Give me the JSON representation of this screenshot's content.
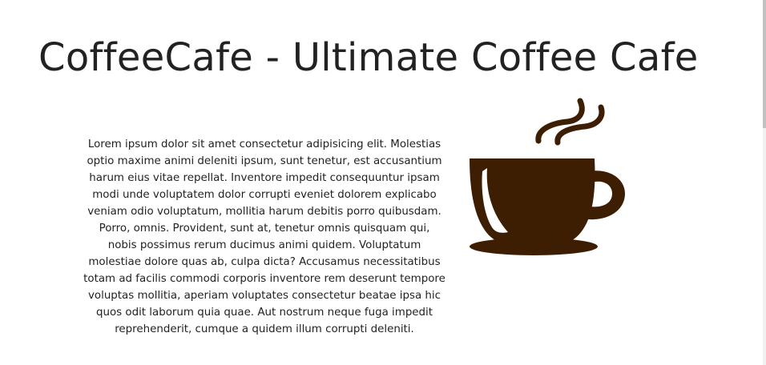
{
  "page": {
    "title": "CoffeeCafe - Ultimate Coffee Cafe",
    "intro": "Lorem ipsum dolor sit amet consectetur adipisicing elit. Molestias optio maxime animi deleniti ipsum, sunt tenetur, est accusantium harum eius vitae repellat. Inventore impedit consequuntur ipsam modi unde voluptatem dolor corrupti eveniet dolorem explicabo veniam odio voluptatum, mollitia harum debitis porro quibusdam. Porro, omnis. Provident, sunt at, tenetur omnis quisquam qui, nobis possimus rerum ducimus animi quidem. Voluptatum molestiae dolore quas ab, culpa dicta? Accusamus necessitatibus totam ad facilis commodi corporis inventore rem deserunt tempore voluptas mollitia, aperiam voluptates consectetur beatae ipsa hic quos odit laborum quia quae. Aut nostrum neque fuga impedit reprehenderit, cumque a quidem illum corrupti deleniti."
  },
  "illustration": {
    "icon": "coffee-cup-icon",
    "color": "#3d1e03"
  }
}
